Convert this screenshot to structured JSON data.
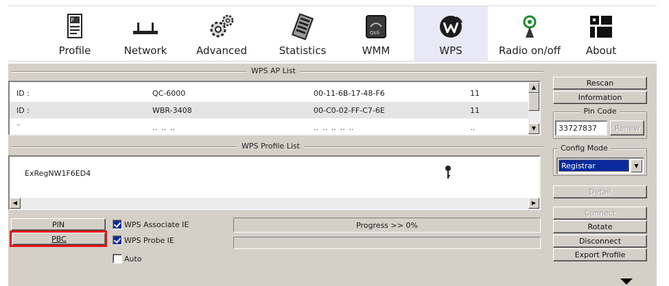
{
  "toolbar": {
    "items": [
      {
        "label": "Profile",
        "icon": "profile-icon"
      },
      {
        "label": "Network",
        "icon": "network-icon"
      },
      {
        "label": "Advanced",
        "icon": "advanced-gears-icon"
      },
      {
        "label": "Statistics",
        "icon": "statistics-icon"
      },
      {
        "label": "WMM",
        "icon": "wmm-qos-icon"
      },
      {
        "label": "WPS",
        "icon": "wps-icon"
      },
      {
        "label": "Radio on/off",
        "icon": "radio-antenna-icon"
      },
      {
        "label": "About",
        "icon": "about-icon"
      }
    ],
    "active": "WPS"
  },
  "ap_list": {
    "caption": "WPS AP List",
    "rows": [
      {
        "id": "ID :",
        "name": "QC-6000",
        "bssid": "00-11-6B-17-48-F6",
        "channel": "11"
      },
      {
        "id": "ID :",
        "name": "WBR-3408",
        "bssid": "00-C0-02-FF-C7-6E",
        "channel": "11"
      }
    ]
  },
  "profile_list": {
    "caption": "WPS Profile List",
    "items": [
      "ExRegNW1F6ED4"
    ]
  },
  "buttons": {
    "pin": "PIN",
    "pbc": "PBC",
    "rescan": "Rescan",
    "information": "Information",
    "renew": "Renew",
    "detail": "Detail",
    "connect": "Connect",
    "rotate": "Rotate",
    "disconnect": "Disconnect",
    "export_profile": "Export Profile"
  },
  "pin_code": {
    "caption": "Pin Code",
    "value": "33727837"
  },
  "config_mode": {
    "caption": "Config Mode",
    "selected": "Registrar"
  },
  "checkboxes": [
    {
      "label": "WPS Associate IE",
      "checked": true
    },
    {
      "label": "WPS Probe IE",
      "checked": true
    },
    {
      "label": "Auto",
      "checked": false
    }
  ],
  "progress": {
    "text": "Progress >> 0%",
    "value": 0
  },
  "colors": {
    "selection": "#0a2a9c",
    "highlight_box": "#e8141b",
    "panel": "#d4d0c8"
  }
}
